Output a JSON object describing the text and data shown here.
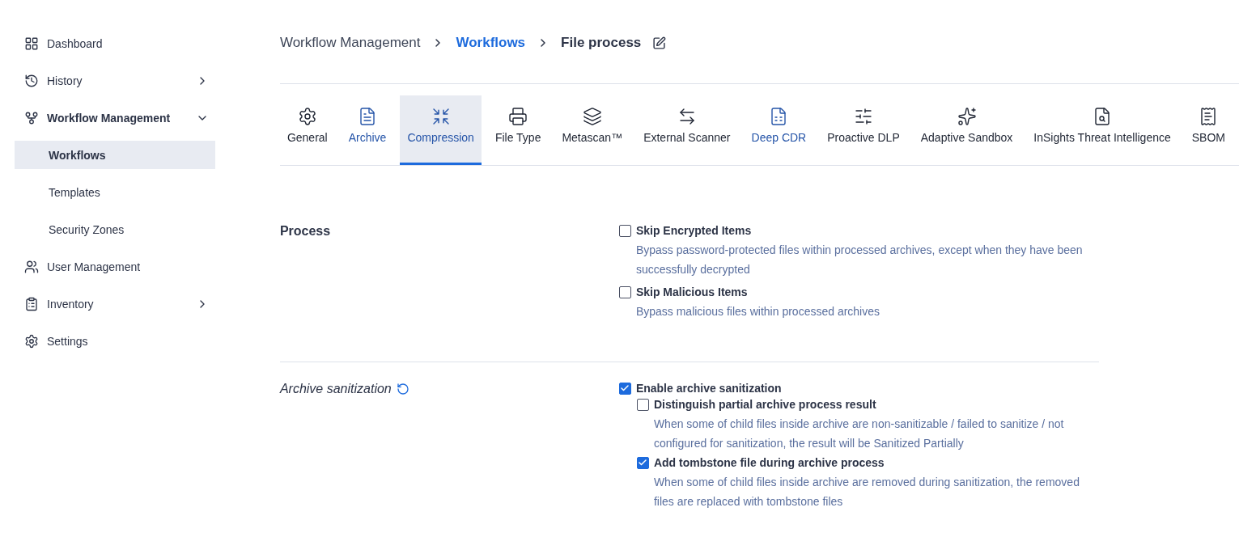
{
  "sidebar": {
    "items": [
      {
        "label": "Dashboard",
        "selected": false
      },
      {
        "label": "History",
        "selected": false,
        "expanded": false
      },
      {
        "label": "Workflow Management",
        "selected": false,
        "expanded": true,
        "children": [
          {
            "label": "Workflows",
            "selected": true
          },
          {
            "label": "Templates",
            "selected": false
          },
          {
            "label": "Security Zones",
            "selected": false
          }
        ]
      },
      {
        "label": "User Management",
        "selected": false
      },
      {
        "label": "Inventory",
        "selected": false,
        "expanded": false
      },
      {
        "label": "Settings",
        "selected": false
      }
    ]
  },
  "breadcrumb": [
    {
      "label": "Workflow Management",
      "kind": "plain"
    },
    {
      "label": "Workflows",
      "kind": "link"
    },
    {
      "label": "File process",
      "kind": "current"
    }
  ],
  "tabs": [
    {
      "label": "General",
      "selected": false,
      "accent": false
    },
    {
      "label": "Archive",
      "selected": false,
      "accent": true
    },
    {
      "label": "Compression",
      "selected": true,
      "accent": true
    },
    {
      "label": "File Type",
      "selected": false,
      "accent": false
    },
    {
      "label": "Metascan™",
      "selected": false,
      "accent": false
    },
    {
      "label": "External Scanner",
      "selected": false,
      "accent": false
    },
    {
      "label": "Deep CDR",
      "selected": false,
      "accent": true
    },
    {
      "label": "Proactive DLP",
      "selected": false,
      "accent": false
    },
    {
      "label": "Adaptive Sandbox",
      "selected": false,
      "accent": false
    },
    {
      "label": "InSights Threat Intelligence",
      "selected": false,
      "accent": false
    },
    {
      "label": "SBOM",
      "selected": false,
      "accent": false
    }
  ],
  "sections": [
    {
      "title": "Process",
      "italic": false,
      "history_icon": false,
      "options": [
        {
          "label": "Skip Encrypted Items",
          "checked": false,
          "description": "Bypass password-protected files within processed archives, except when they have been successfully decrypted"
        },
        {
          "label": "Skip Malicious Items",
          "checked": false,
          "description": "Bypass malicious files within processed archives"
        }
      ]
    },
    {
      "title": "Archive sanitization",
      "italic": true,
      "history_icon": true,
      "options": [
        {
          "label": "Enable archive sanitization",
          "checked": true,
          "children": [
            {
              "label": "Distinguish partial archive process result",
              "checked": false,
              "description": "When some of child files inside archive are non-sanitizable / failed to sanitize / not configured for sanitization, the result will be Sanitized Partially"
            },
            {
              "label": "Add tombstone file during archive process",
              "checked": true,
              "description": "When some of child files inside archive are removed during sanitization, the removed files are replaced with tombstone files"
            }
          ]
        }
      ]
    }
  ]
}
